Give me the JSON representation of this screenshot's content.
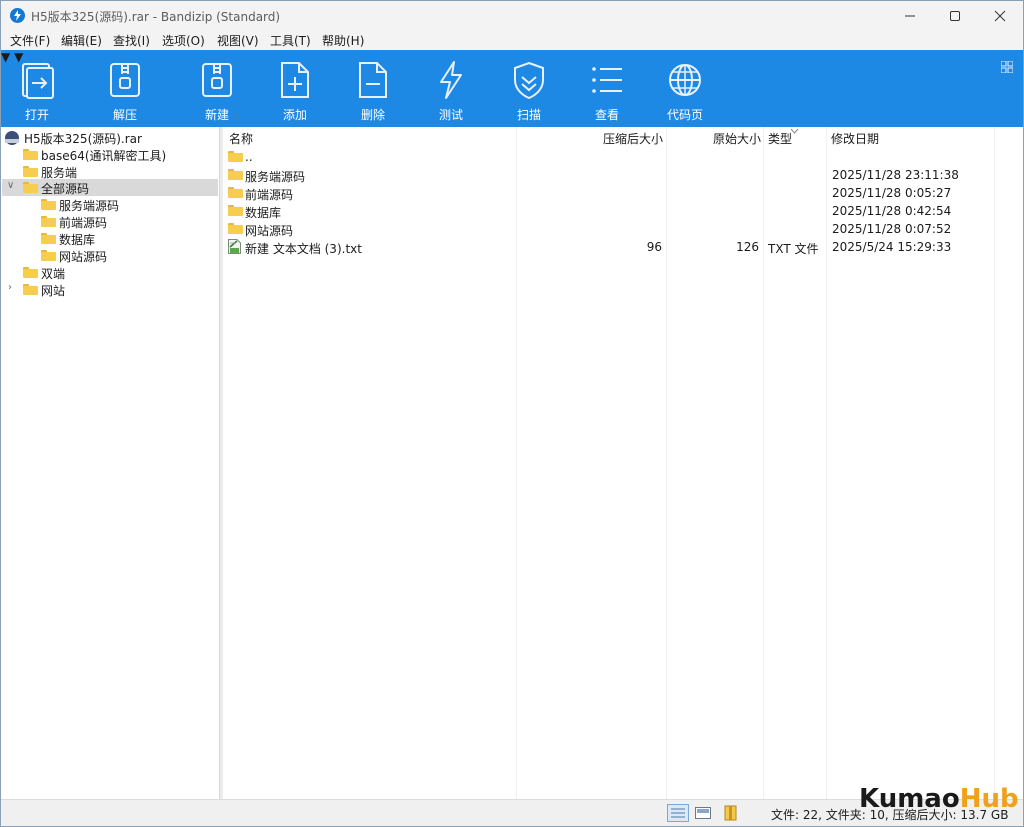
{
  "window": {
    "title": "H5版本325(源码).rar - Bandizip (Standard)"
  },
  "menu": [
    "文件(F)",
    "编辑(E)",
    "查找(I)",
    "选项(O)",
    "视图(V)",
    "工具(T)",
    "帮助(H)"
  ],
  "toolbar": {
    "open": "打开",
    "extract": "解压",
    "new": "新建",
    "add": "添加",
    "delete": "删除",
    "test": "测试",
    "scan": "扫描",
    "view": "查看",
    "codepage": "代码页"
  },
  "tree": {
    "root": "H5版本325(源码).rar",
    "items": [
      {
        "label": "base64(通讯解密工具)"
      },
      {
        "label": "服务端"
      },
      {
        "label": "全部源码",
        "selected": true,
        "expanded": true
      },
      {
        "label": "服务端源码"
      },
      {
        "label": "前端源码"
      },
      {
        "label": "数据库"
      },
      {
        "label": "网站源码"
      },
      {
        "label": "双端"
      },
      {
        "label": "网站",
        "collapsed": true
      }
    ]
  },
  "list": {
    "headers": {
      "name": "名称",
      "packed": "压缩后大小",
      "original": "原始大小",
      "type": "类型",
      "modified": "修改日期"
    },
    "rows": [
      {
        "name": "..",
        "packed": "",
        "original": "",
        "type": "",
        "modified": ""
      },
      {
        "name": "服务端源码",
        "packed": "",
        "original": "",
        "type": "",
        "modified": "2025/11/28 23:11:38"
      },
      {
        "name": "前端源码",
        "packed": "",
        "original": "",
        "type": "",
        "modified": "2025/11/28 0:05:27"
      },
      {
        "name": "数据库",
        "packed": "",
        "original": "",
        "type": "",
        "modified": "2025/11/28 0:42:54"
      },
      {
        "name": "网站源码",
        "packed": "",
        "original": "",
        "type": "",
        "modified": "2025/11/28 0:07:52"
      },
      {
        "name": "新建 文本文档 (3).txt",
        "packed": "96",
        "original": "126",
        "type": "TXT 文件",
        "modified": "2025/5/24 15:29:33"
      }
    ]
  },
  "status": {
    "text": "文件: 22, 文件夹: 10, 压缩后大小: 13.7 GB"
  },
  "watermark": {
    "part1": "Kumao",
    "part2": "Hub"
  },
  "colors": {
    "toolbar": "#1e88e5",
    "folder": "#f6cd4e",
    "selection": "#d9d9d9"
  }
}
